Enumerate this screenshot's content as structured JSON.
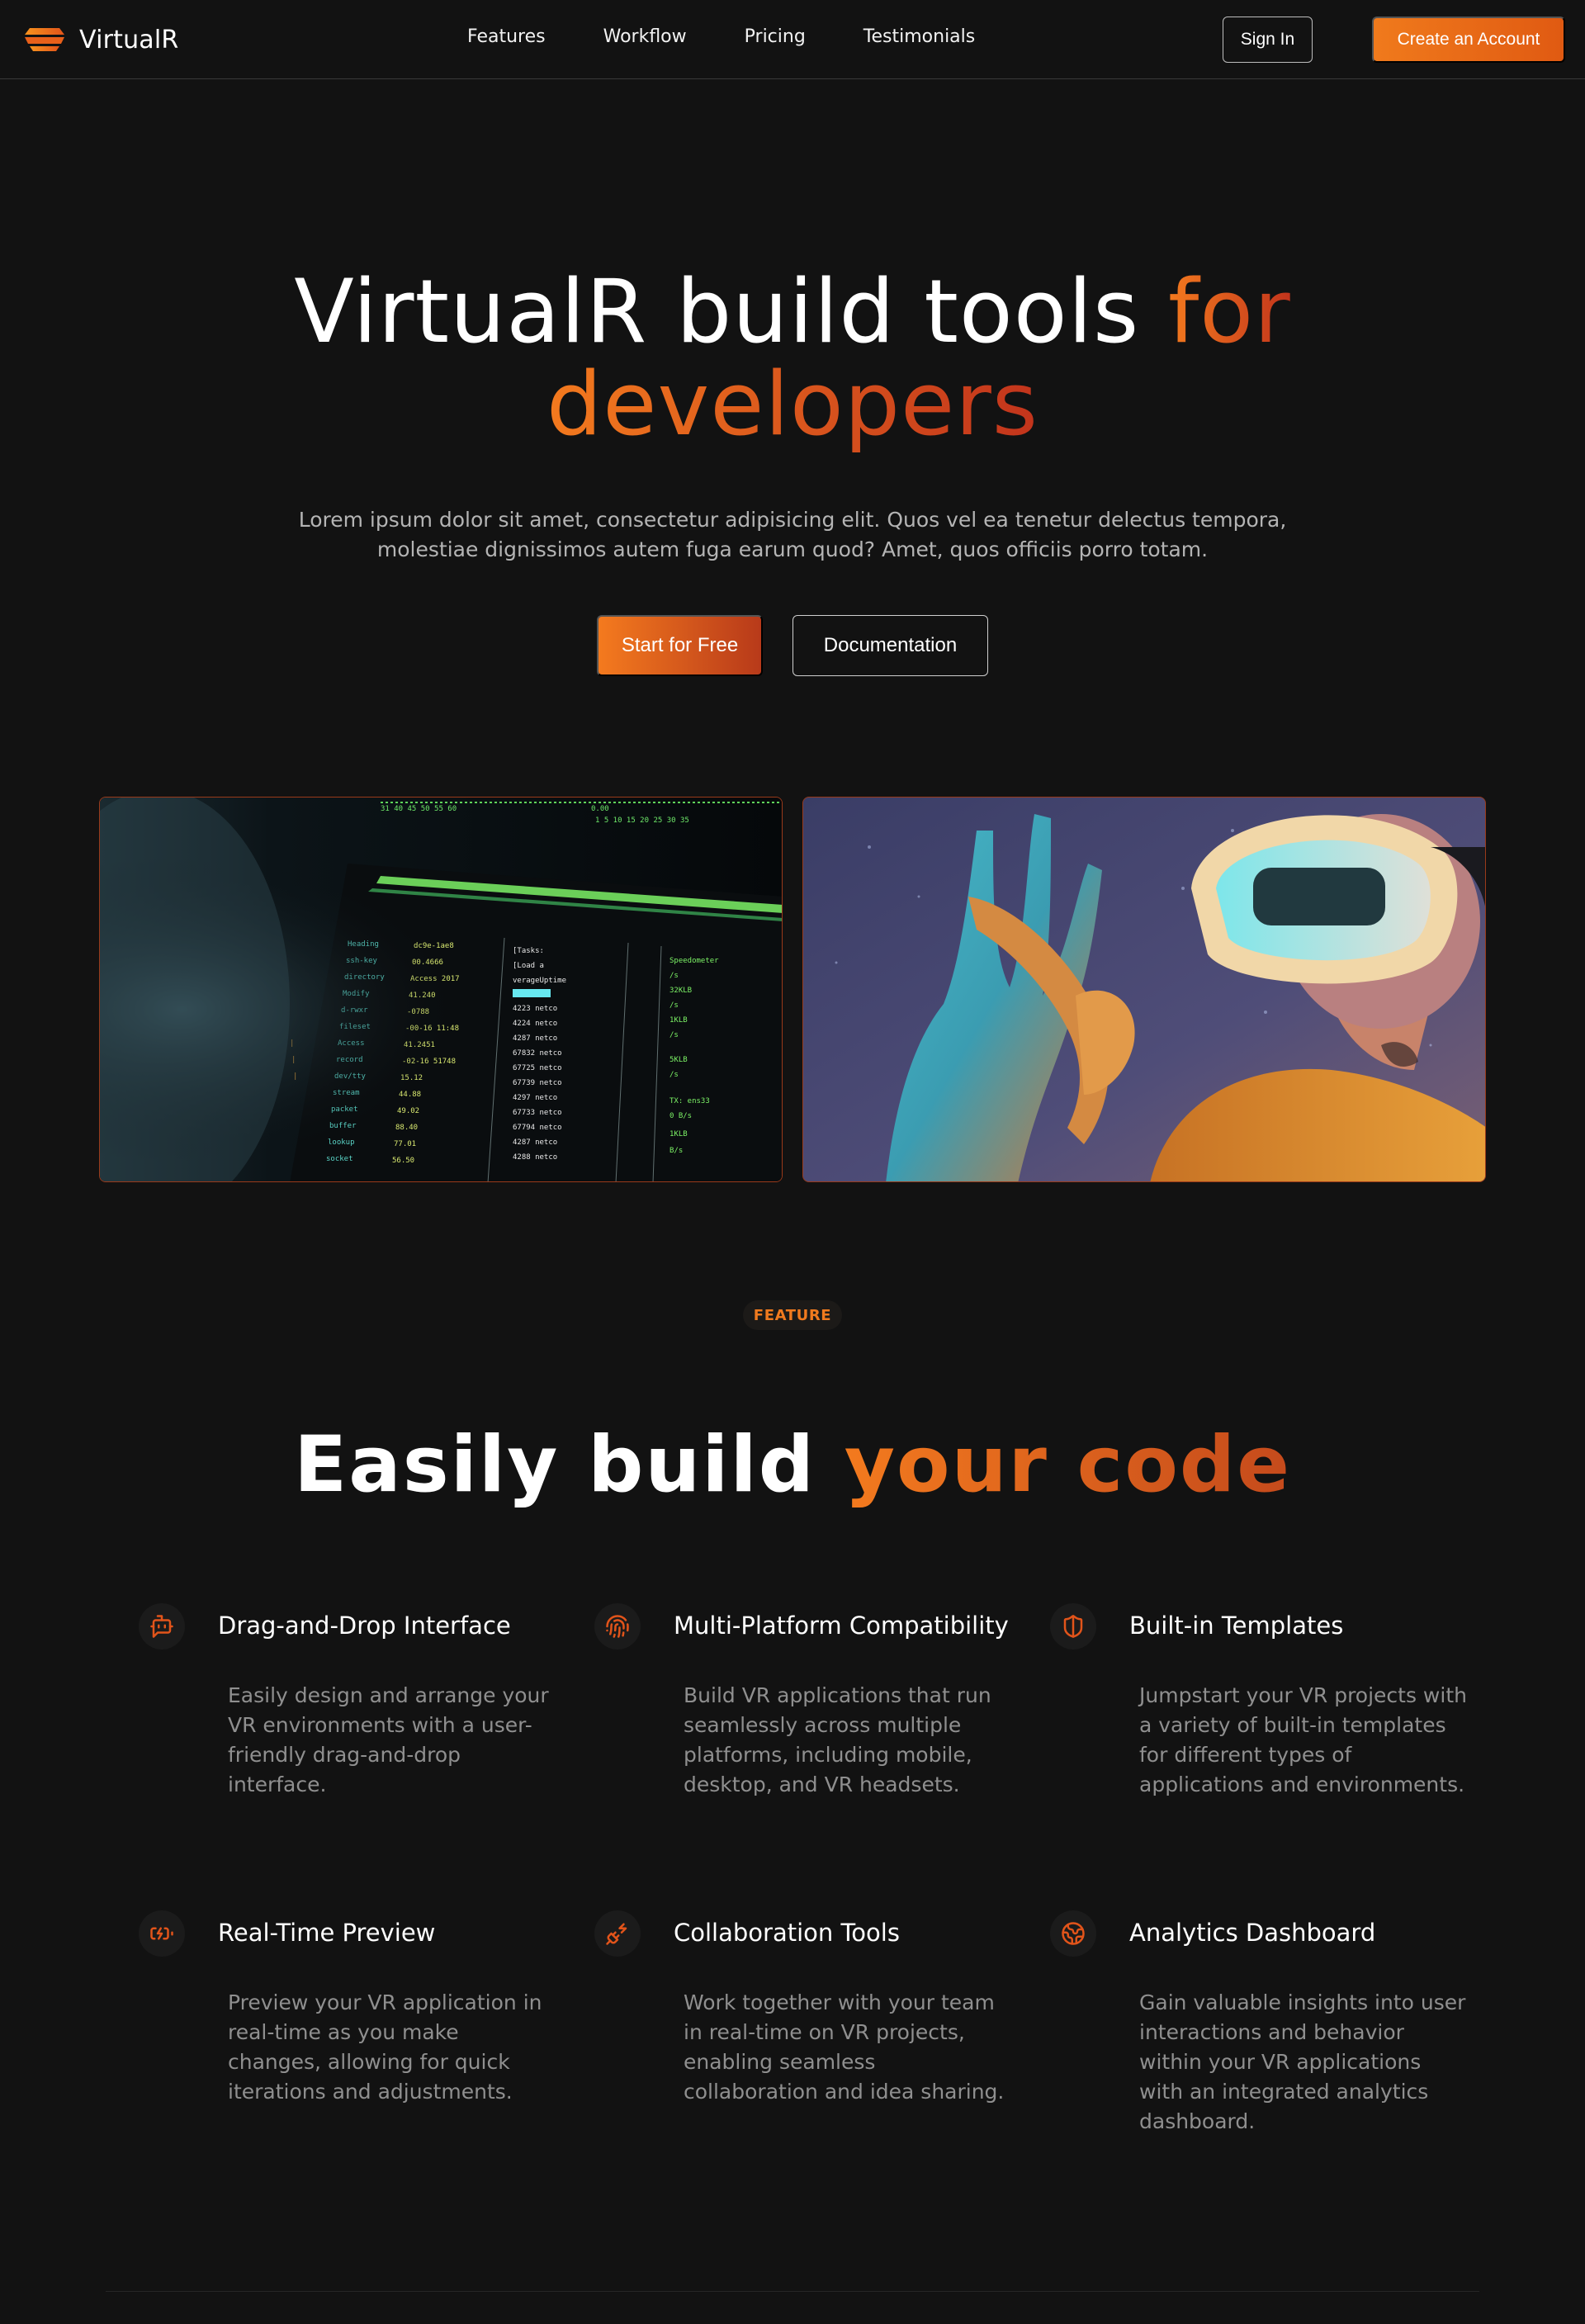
{
  "nav": {
    "brand": "VirtualR",
    "links": [
      "Features",
      "Workflow",
      "Pricing",
      "Testimonials"
    ],
    "sign_in": "Sign In",
    "create_account": "Create an Account"
  },
  "hero": {
    "title_part1": "VirtualR build tools ",
    "title_accent1": "for",
    "title_accent2": "developers",
    "subtitle": "Lorem ipsum dolor sit amet, consectetur adipisicing elit. Quos vel ea tenetur delectus tempora, molestiae dignissimos autem fuga earum quod? Amet, quos officiis porro totam.",
    "start_button": "Start for Free",
    "docs_button": "Documentation"
  },
  "features_section": {
    "badge": "FEATURE",
    "title_white": "Easily build ",
    "title_accent": "your code",
    "items": [
      {
        "icon": "bot-icon",
        "title": "Drag-and-Drop Interface",
        "desc": "Easily design and arrange your VR environments with a user-friendly drag-and-drop interface."
      },
      {
        "icon": "fingerprint-icon",
        "title": "Multi-Platform Compatibility",
        "desc": "Build VR applications that run seamlessly across multiple platforms, including mobile, desktop, and VR headsets."
      },
      {
        "icon": "shield-half-icon",
        "title": "Built-in Templates",
        "desc": "Jumpstart your VR projects with a variety of built-in templates for different types of applications and environments."
      },
      {
        "icon": "battery-charging-icon",
        "title": "Real-Time Preview",
        "desc": "Preview your VR application in real-time as you make changes, allowing for quick iterations and adjustments."
      },
      {
        "icon": "plug-zap-icon",
        "title": "Collaboration Tools",
        "desc": "Work together with your team in real-time on VR projects, enabling seamless collaboration and idea sharing."
      },
      {
        "icon": "globe-icon",
        "title": "Analytics Dashboard",
        "desc": "Gain valuable insights into user interactions and behavior within your VR applications with an integrated analytics dashboard."
      }
    ]
  },
  "colors": {
    "background": "#121212",
    "accent_orange": "#f07a1e",
    "accent_red": "#c2341c",
    "muted_text": "#8f8f8f"
  }
}
